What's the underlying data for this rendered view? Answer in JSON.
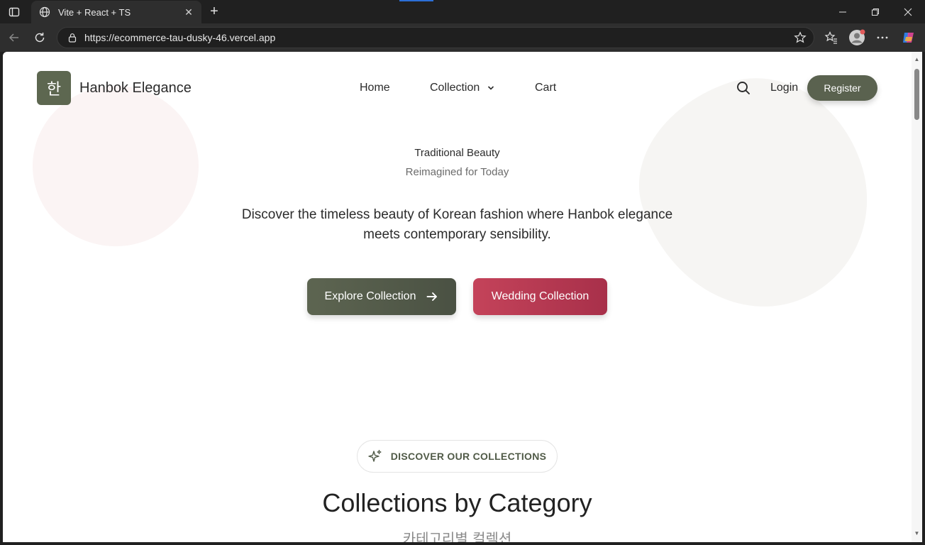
{
  "browser": {
    "tab_title": "Vite + React + TS",
    "url": "https://ecommerce-tau-dusky-46.vercel.app"
  },
  "header": {
    "logo_char": "한",
    "brand": "Hanbok Elegance",
    "nav": {
      "home": "Home",
      "collection": "Collection",
      "cart": "Cart"
    },
    "login": "Login",
    "register": "Register"
  },
  "hero": {
    "eyebrow": "Traditional Beauty",
    "subtitle": "Reimagined for Today",
    "description": "Discover the timeless beauty of Korean fashion where Hanbok elegance meets contemporary sensibility.",
    "explore_label": "Explore Collection",
    "wedding_label": "Wedding Collection"
  },
  "collections": {
    "badge": "DISCOVER OUR COLLECTIONS",
    "title": "Collections by Category",
    "subtitle": "카테고리별 컬렉션"
  },
  "colors": {
    "primary_green": "#5a624f",
    "wedding_red": "#b63a52"
  }
}
